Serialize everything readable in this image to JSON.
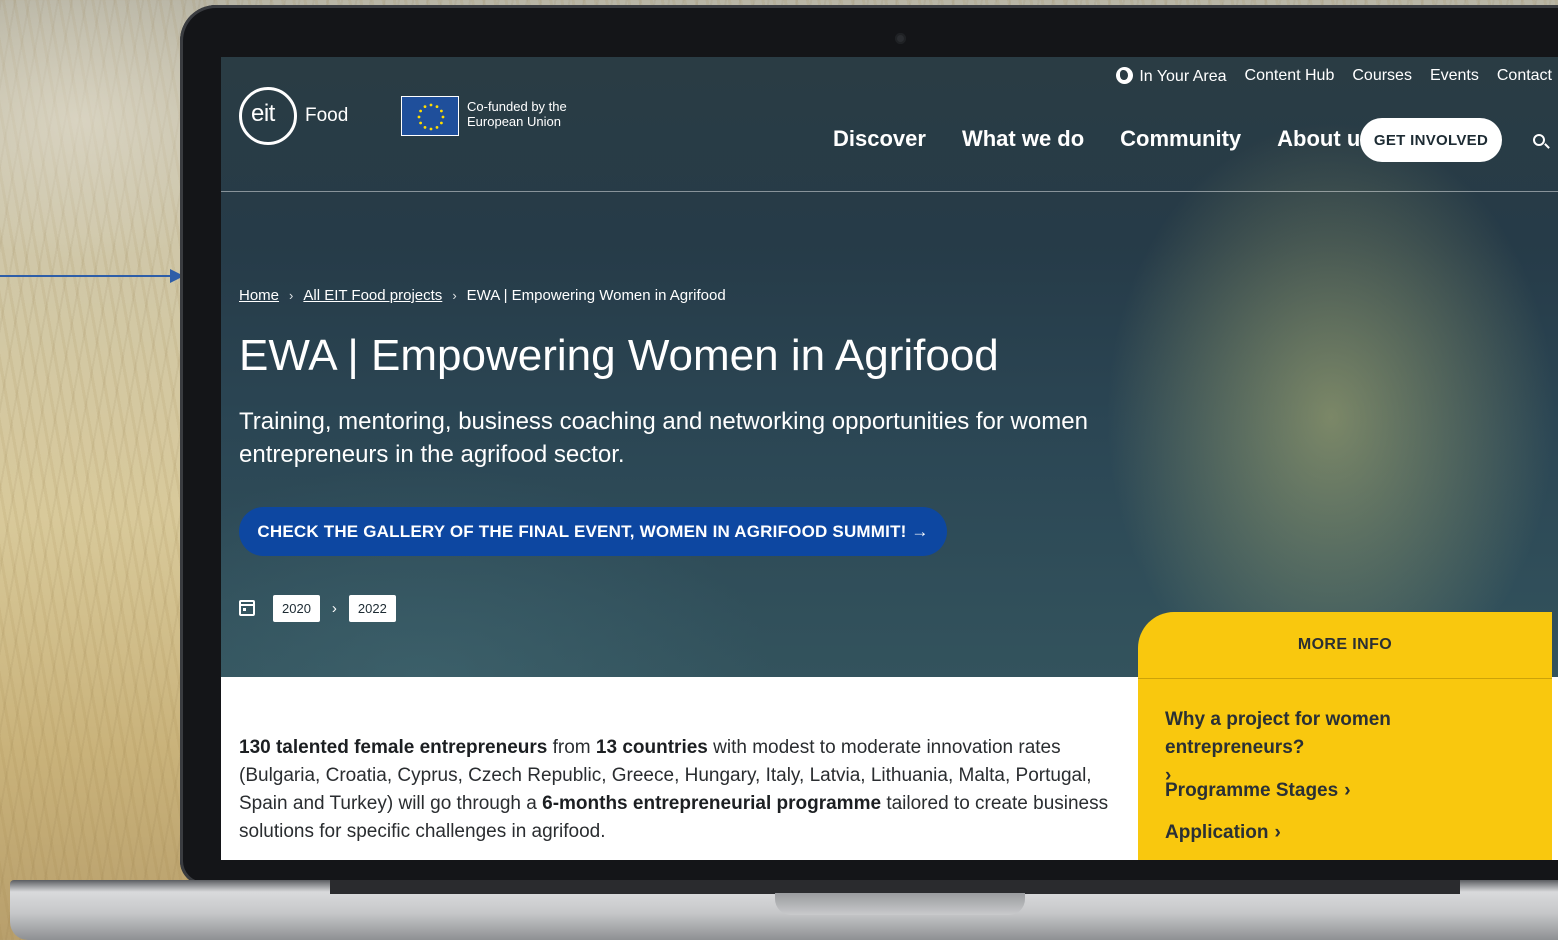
{
  "utility_nav": {
    "items": [
      "In Your Area",
      "Content Hub",
      "Courses",
      "Events",
      "Contact"
    ]
  },
  "logo": {
    "brand": "eit",
    "product": "Food",
    "eu_text": "Co-funded by the European Union"
  },
  "main_nav": {
    "items": [
      "Discover",
      "What we do",
      "Community",
      "About us"
    ],
    "cta": "GET INVOLVED"
  },
  "breadcrumb": {
    "home": "Home",
    "projects": "All EIT Food projects",
    "current": "EWA | Empowering Women in Agrifood",
    "separator": "›"
  },
  "hero": {
    "title": "EWA | Empowering Women in Agrifood",
    "subtitle": "Training, mentoring, business coaching and networking opportunities for women entrepreneurs in the agrifood sector.",
    "cta": "CHECK THE GALLERY OF THE FINAL EVENT, WOMEN IN AGRIFOOD SUMMIT! →",
    "date_start": "2020",
    "date_end": "2022",
    "date_separator": "›"
  },
  "body": {
    "bold1": "130 talented female entrepreneurs",
    "text1": " from ",
    "bold2": "13 countries",
    "text2": " with modest to moderate innovation rates (Bulgaria, Croatia, Cyprus, Czech Republic, Greece, Hungary, Italy, Latvia, Lithuania, Malta, Portugal, Spain and Turkey) will go through a ",
    "bold3": "6-months entrepreneurial programme",
    "text3": " tailored to create business solutions for specific challenges in agrifood."
  },
  "more_info": {
    "title": "MORE INFO",
    "links": [
      "Why a project for women entrepreneurs?",
      "Programme Stages",
      "Application"
    ],
    "chevron": "›"
  },
  "colors": {
    "hero_bg": "#263b48",
    "cta_blue": "#0d47a1",
    "panel_yellow": "#f9c80e",
    "pointer_line": "#2e5ea8"
  }
}
